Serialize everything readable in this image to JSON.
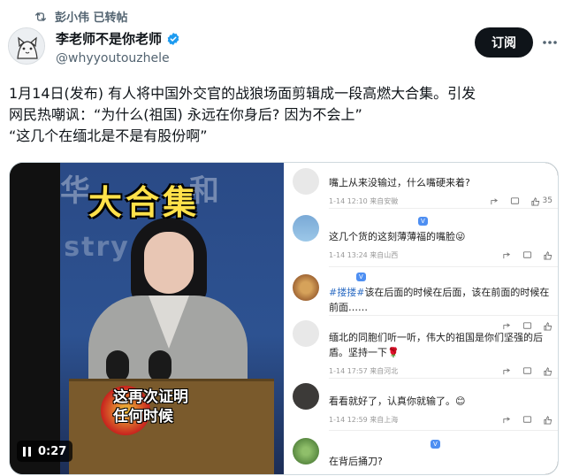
{
  "retweet": {
    "label": "彭小伟 已转帖"
  },
  "author": {
    "name": "李老师不是你老师",
    "handle": "@whyyoutouzhele"
  },
  "actions": {
    "subscribe_label": "订阅"
  },
  "tweet": {
    "lines": [
      "1月14日(发布) 有人将中国外交官的战狼场面剪辑成一段高燃大合集。引发",
      "网民热嘲讽：“为什么(祖国) 永远在你身后? 因为不会上”",
      " “这几个在缅北是不是有股份啊”"
    ]
  },
  "video": {
    "title_overlay": "大合集",
    "subtitle_line1": "这再次证明",
    "subtitle_line2": "任何时候",
    "time": "0:27"
  },
  "comments": [
    {
      "text": "嘴上从来没输过，什么嘴硬来着?",
      "date": "1-14 12:10 来自安徽",
      "likes": "35"
    },
    {
      "text": "这几个货的这刻薄薄福的嘴脸😜",
      "date": "1-14 13:24 来自山西",
      "likes": ""
    },
    {
      "mention": "#搂搂#",
      "text": "该在后面的时候在后面，该在前面的时候在前面……",
      "date": "",
      "likes": ""
    },
    {
      "text": "缅北的同胞们听一听，伟大的祖国是你们坚强的后盾。坚持一下🌹",
      "date": "1-14 17:57 来自河北",
      "likes": ""
    },
    {
      "text": "看看就好了，认真你就输了。😊",
      "date": "1-14 12:59 来自上海",
      "likes": ""
    },
    {
      "text": "在背后捅刀?",
      "date": "",
      "likes": ""
    }
  ],
  "colors": {
    "accent": "#1d9bf0",
    "text": "#0f1419",
    "muted": "#536471"
  }
}
